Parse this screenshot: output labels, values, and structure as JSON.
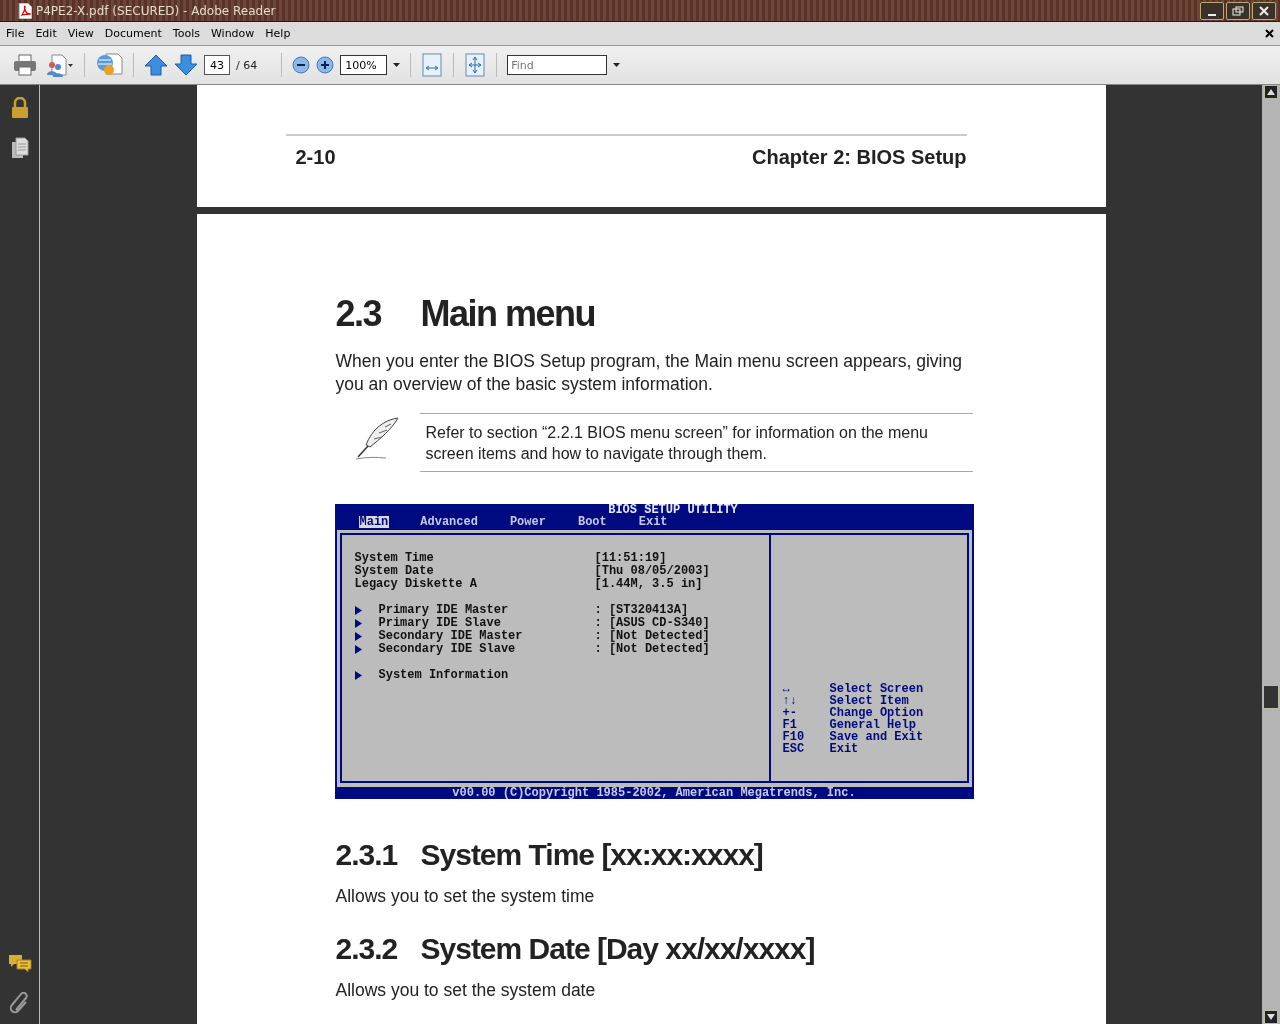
{
  "window": {
    "title": "P4PE2-X.pdf (SECURED) - Adobe Reader"
  },
  "menu_bar": {
    "items": [
      "File",
      "Edit",
      "View",
      "Document",
      "Tools",
      "Window",
      "Help"
    ]
  },
  "toolbar": {
    "page_number": "43",
    "page_total": "/ 64",
    "zoom": "100%",
    "find": {
      "placeholder": "Find"
    }
  },
  "previous_page": {
    "page_label": "2-10",
    "chapter": "Chapter 2: BIOS Setup"
  },
  "page": {
    "heading": {
      "number": "2.3",
      "title": "Main menu"
    },
    "intro": "When you enter the BIOS Setup program, the Main menu screen appears, giving you an overview of the basic system information.",
    "note": "Refer to section “2.2.1  BIOS menu screen” for information on the menu screen items and how to navigate through them.",
    "bios_screen": {
      "title": "BIOS SETUP UTILITY",
      "tabs": [
        {
          "label": "Main",
          "selected": true
        },
        {
          "label": "Advanced",
          "selected": false
        },
        {
          "label": "Power",
          "selected": false
        },
        {
          "label": "Boot",
          "selected": false
        },
        {
          "label": "Exit",
          "selected": false
        }
      ],
      "item_groups": [
        [
          {
            "kind": "field",
            "label": "System Time",
            "value": "[11:51:19]"
          },
          {
            "kind": "field",
            "label": "System Date",
            "value": "[Thu 08/05/2003]"
          },
          {
            "kind": "field",
            "label": "Legacy Diskette A",
            "value": "[1.44M, 3.5 in]"
          }
        ],
        [
          {
            "kind": "submenu",
            "label": "Primary IDE Master",
            "value": ": [ST320413A]"
          },
          {
            "kind": "submenu",
            "label": "Primary IDE Slave",
            "value": ": [ASUS CD-S340]"
          },
          {
            "kind": "submenu",
            "label": "Secondary IDE Master",
            "value": ": [Not Detected]"
          },
          {
            "kind": "submenu",
            "label": "Secondary IDE Slave",
            "value": ": [Not Detected]"
          }
        ],
        [
          {
            "kind": "submenu",
            "label": "System Information"
          }
        ]
      ],
      "keys": [
        {
          "key": "↔",
          "action": "Select Screen"
        },
        {
          "key": "↑↓",
          "action": "Select Item"
        },
        {
          "key": "+-",
          "action": "Change Option"
        },
        {
          "key": "F1",
          "action": "General Help"
        },
        {
          "key": "F10",
          "action": "Save and Exit"
        },
        {
          "key": "ESC",
          "action": "Exit"
        }
      ],
      "copyright": "v00.00 (C)Copyright 1985-2002, American Megatrends, Inc."
    },
    "sections": [
      {
        "number": "2.3.1",
        "title": "System Time [xx:xx:xxxx]",
        "text": "Allows you to set the system time"
      },
      {
        "number": "2.3.2",
        "title": "System Date [Day xx/xx/xxxx]",
        "text": "Allows you to set the system date"
      }
    ]
  }
}
